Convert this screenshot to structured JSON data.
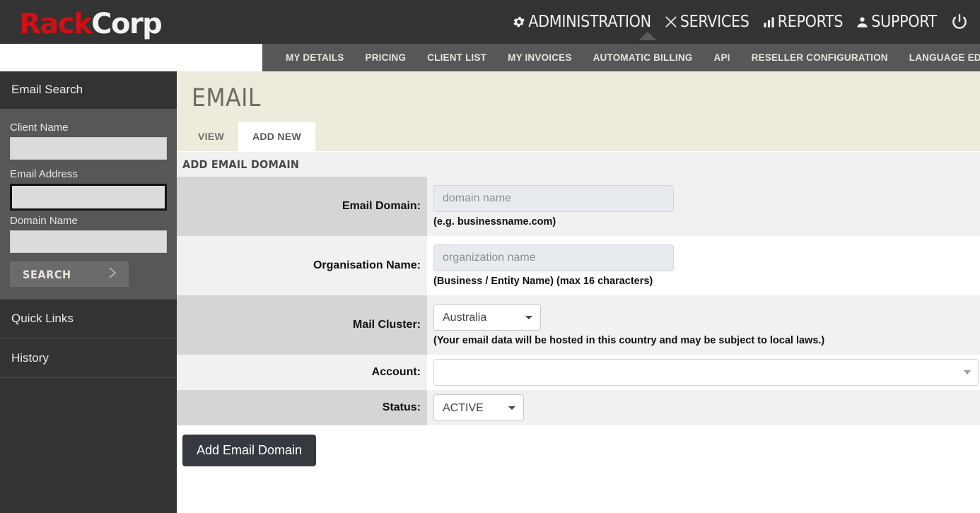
{
  "brand": {
    "part1": "Rack",
    "part2": "Corp"
  },
  "topnav": {
    "items": [
      {
        "label": "ADMINISTRATION",
        "icon": "gear-icon",
        "active": true
      },
      {
        "label": "SERVICES",
        "icon": "tools-icon",
        "active": false
      },
      {
        "label": "REPORTS",
        "icon": "bar-chart-icon",
        "active": false
      },
      {
        "label": "SUPPORT",
        "icon": "person-icon",
        "active": false
      }
    ],
    "power_icon": "power-icon"
  },
  "subnav": {
    "items": [
      "MY DETAILS",
      "PRICING",
      "CLIENT LIST",
      "MY INVOICES",
      "AUTOMATIC BILLING",
      "API",
      "RESELLER CONFIGURATION",
      "LANGUAGE EDITOR"
    ]
  },
  "sidebar": {
    "title": "Email Search",
    "fields": [
      {
        "label": "Client Name",
        "value": "",
        "focused": false
      },
      {
        "label": "Email Address",
        "value": "",
        "focused": true
      },
      {
        "label": "Domain Name",
        "value": "",
        "focused": false
      }
    ],
    "search_button": "SEARCH",
    "links": [
      {
        "label": "Quick Links"
      },
      {
        "label": "History"
      }
    ]
  },
  "page": {
    "title": "EMAIL",
    "tabs": [
      {
        "label": "VIEW",
        "active": false
      },
      {
        "label": "ADD NEW",
        "active": true
      }
    ],
    "section_title": "ADD EMAIL DOMAIN"
  },
  "form": {
    "rows": [
      {
        "label": "Email Domain:",
        "type": "text",
        "placeholder": "domain name",
        "value": "",
        "hint": "(e.g. businessname.com)"
      },
      {
        "label": "Organisation Name:",
        "type": "text",
        "placeholder": "organization name",
        "value": "",
        "hint": "(Business / Entity Name) (max 16 characters)"
      },
      {
        "label": "Mail Cluster:",
        "type": "select",
        "value": "Australia",
        "options": [
          "Australia"
        ],
        "hint": "(Your email data will be hosted in this country and may be subject to local laws.)"
      },
      {
        "label": "Account:",
        "type": "select-wide",
        "value": "",
        "options": [
          ""
        ],
        "hint": ""
      },
      {
        "label": "Status:",
        "type": "select",
        "value": "ACTIVE",
        "options": [
          "ACTIVE"
        ],
        "hint": ""
      }
    ],
    "submit_label": "Add Email Domain"
  },
  "colors": {
    "brand_red": "#cf1017",
    "header_dark": "#333333",
    "subnav_gray": "#575757",
    "page_head": "#ecebdc",
    "button_dark": "#343a40"
  }
}
